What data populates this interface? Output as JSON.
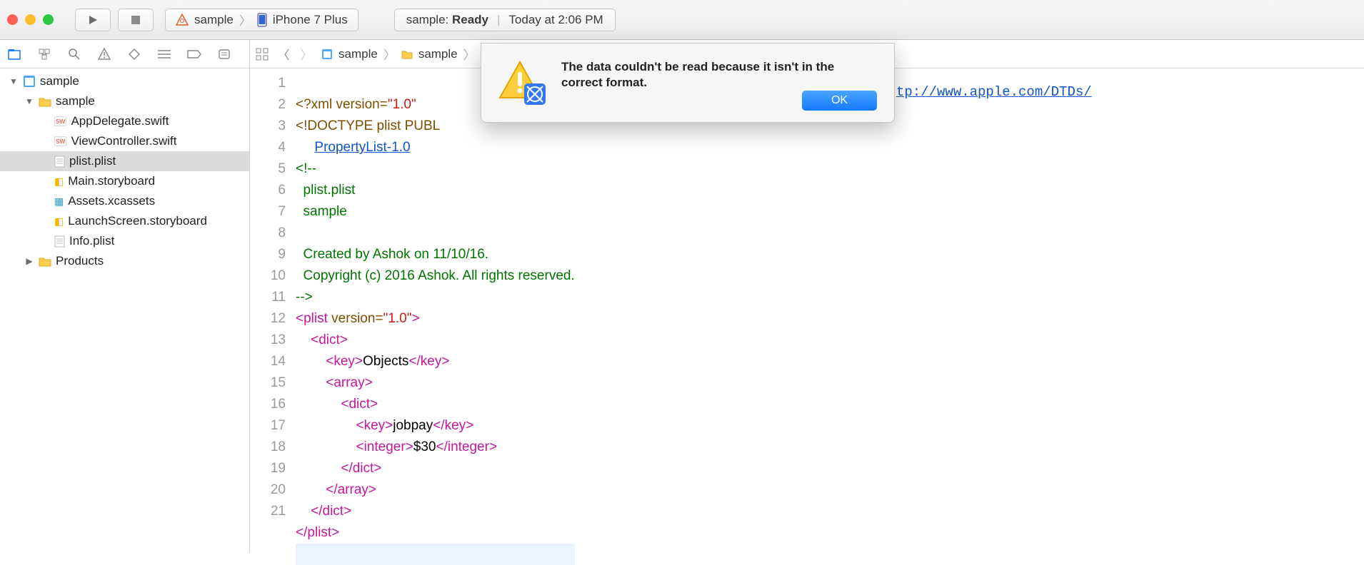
{
  "toolbar": {
    "scheme_project": "sample",
    "scheme_device": "iPhone 7 Plus",
    "status_prefix": "sample: ",
    "status_word": "Ready",
    "status_time": "Today at 2:06 PM"
  },
  "breadcrumb": {
    "items": [
      "sample",
      "sample"
    ]
  },
  "sidebar": {
    "root": "sample",
    "group": "sample",
    "files": [
      "AppDelegate.swift",
      "ViewController.swift",
      "plist.plist",
      "Main.storyboard",
      "Assets.xcassets",
      "LaunchScreen.storyboard",
      "Info.plist"
    ],
    "products": "Products",
    "selected_index": 2
  },
  "alert": {
    "message": "The data couldn't be read because it isn't in the correct format.",
    "ok": "OK"
  },
  "far_url": "tp://www.apple.com/DTDs/",
  "code": {
    "line1_a": "<?xml version=",
    "line1_b": "\"1.0\"",
    "line2_a": "<!DOCTYPE plist PUBL",
    "line2b_a": "PropertyList-1.0",
    "line3": "<!--",
    "line4": "  plist.plist",
    "line5": "  sample",
    "line6": "",
    "line7": "  Created by Ashok on 11/10/16.",
    "line8": "  Copyright (c) 2016 Ashok. All rights reserved.",
    "line9": "-->",
    "plist_open_a": "<plist ",
    "plist_open_b": "version",
    "plist_open_c": "=",
    "plist_open_d": "\"1.0\"",
    "plist_open_e": ">",
    "dict_open": "<dict>",
    "key_open": "<key>",
    "key_close": "</key>",
    "key_objects": "Objects",
    "array_open": "<array>",
    "array_close": "</array>",
    "dict2_open": "<dict>",
    "dict2_close": "</dict>",
    "key_jobpay": "jobpay",
    "int_open": "<integer>",
    "int_val": "$30",
    "int_close": "</integer>",
    "dict_close": "</dict>",
    "plist_close": "</plist>"
  },
  "linecount": 21
}
